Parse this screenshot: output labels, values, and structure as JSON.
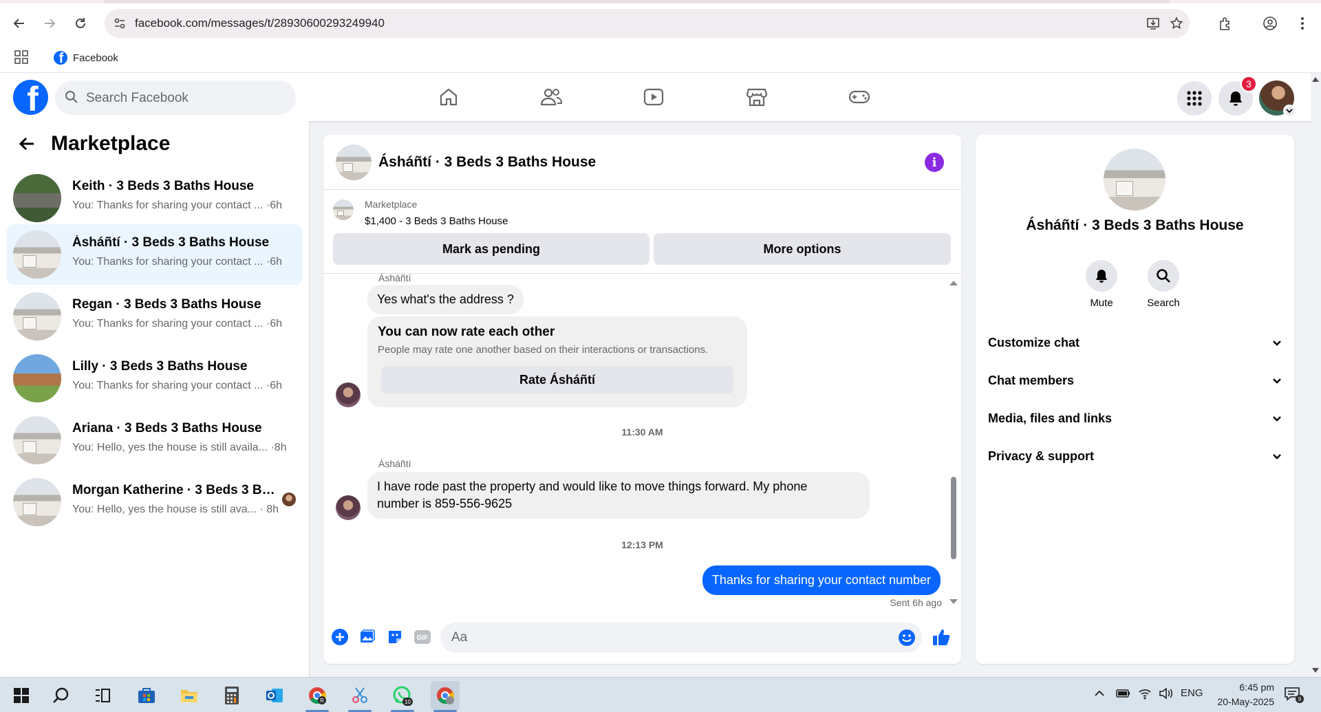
{
  "browser": {
    "url": "facebook.com/messages/t/28930600293249940",
    "bookmark_label": "Facebook"
  },
  "header": {
    "search_placeholder": "Search Facebook",
    "notification_count": "3"
  },
  "left_panel": {
    "title": "Marketplace",
    "conversations": [
      {
        "name": "Keith · 3 Beds 3 Baths House",
        "snippet": "You: Thanks for sharing your contact ...",
        "time": "·6h",
        "active": false
      },
      {
        "name": "Ásháñtí · 3 Beds 3 Baths House",
        "snippet": "You: Thanks for sharing your contact ...",
        "time": "·6h",
        "active": true
      },
      {
        "name": "Regan · 3 Beds 3 Baths House",
        "snippet": "You: Thanks for sharing your contact ...",
        "time": "·6h",
        "active": false
      },
      {
        "name": "Lilly · 3 Beds 3 Baths House",
        "snippet": "You: Thanks for sharing your contact ...",
        "time": "·6h",
        "active": false
      },
      {
        "name": "Ariana · 3 Beds 3 Baths House",
        "snippet": "You: Hello, yes the house is still availa...",
        "time": "·8h",
        "active": false
      },
      {
        "name": "Morgan Katherine · 3 Beds 3 Bat...",
        "snippet": "You: Hello, yes the house is still ava...",
        "time": "· 8h",
        "active": false
      }
    ]
  },
  "chat": {
    "title": "Ásháñtí · 3 Beds 3 Baths House",
    "listing_category": "Marketplace",
    "listing_price": "$1,400 - 3 Beds 3 Baths House",
    "mark_pending_label": "Mark as pending",
    "more_options_label": "More options",
    "messages": {
      "sender1": "Ásháñtí",
      "msg1": "Yes what's the address ?",
      "rate_title": "You can now rate each other",
      "rate_sub": "People may rate one another based on their interactions or transactions.",
      "rate_button": "Rate Ásháñtí",
      "time1": "11:30 AM",
      "sender2": "Ásháñtí",
      "msg2_line1": "I have rode past the property and would like to move things forward. My phone",
      "msg2_line2": "number is 859-556-9625",
      "time2": "12:13 PM",
      "msg3": "Thanks for sharing your contact number",
      "sent_note": "Sent 6h ago"
    },
    "composer_placeholder": "Aa"
  },
  "right_panel": {
    "title": "Ásháñtí · 3 Beds 3 Baths House",
    "mute_label": "Mute",
    "search_label": "Search",
    "sections": [
      "Customize chat",
      "Chat members",
      "Media, files and links",
      "Privacy & support"
    ]
  },
  "taskbar": {
    "whatsapp_badge": "10",
    "language": "ENG",
    "time": "6:45 pm",
    "date": "20-May-2025",
    "notif_count": "9"
  },
  "colors": {
    "brand": "#0866ff",
    "active_conv": "#ebf5ff",
    "info_icon": "#8a2be2"
  }
}
